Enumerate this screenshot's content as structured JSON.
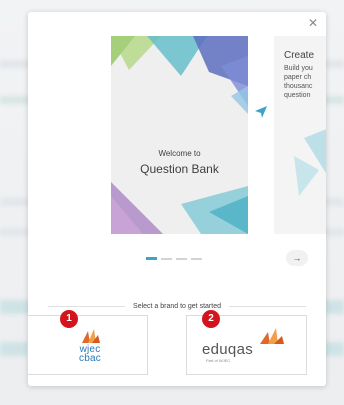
{
  "carousel": {
    "slide1": {
      "line1": "Welcome to",
      "line2": "Question Bank"
    },
    "slide2": {
      "title": "Create",
      "body": "Build you\npaper ch\nthousanc\nquestion"
    },
    "pagination": {
      "count": 4,
      "active": 1
    }
  },
  "brand_selector": {
    "prompt": "Select a brand to get started",
    "brands": [
      {
        "badge": "1",
        "logo_line1": "wjec",
        "logo_line2": "cbac"
      },
      {
        "badge": "2",
        "logo_name": "eduqas",
        "logo_sub": "Part of WJEC"
      }
    ]
  },
  "colors": {
    "accent": "#3ea4c7",
    "badge": "#d4141c",
    "wjec_blue": "#2a7ab6",
    "logo_orange": "#e0692a"
  }
}
